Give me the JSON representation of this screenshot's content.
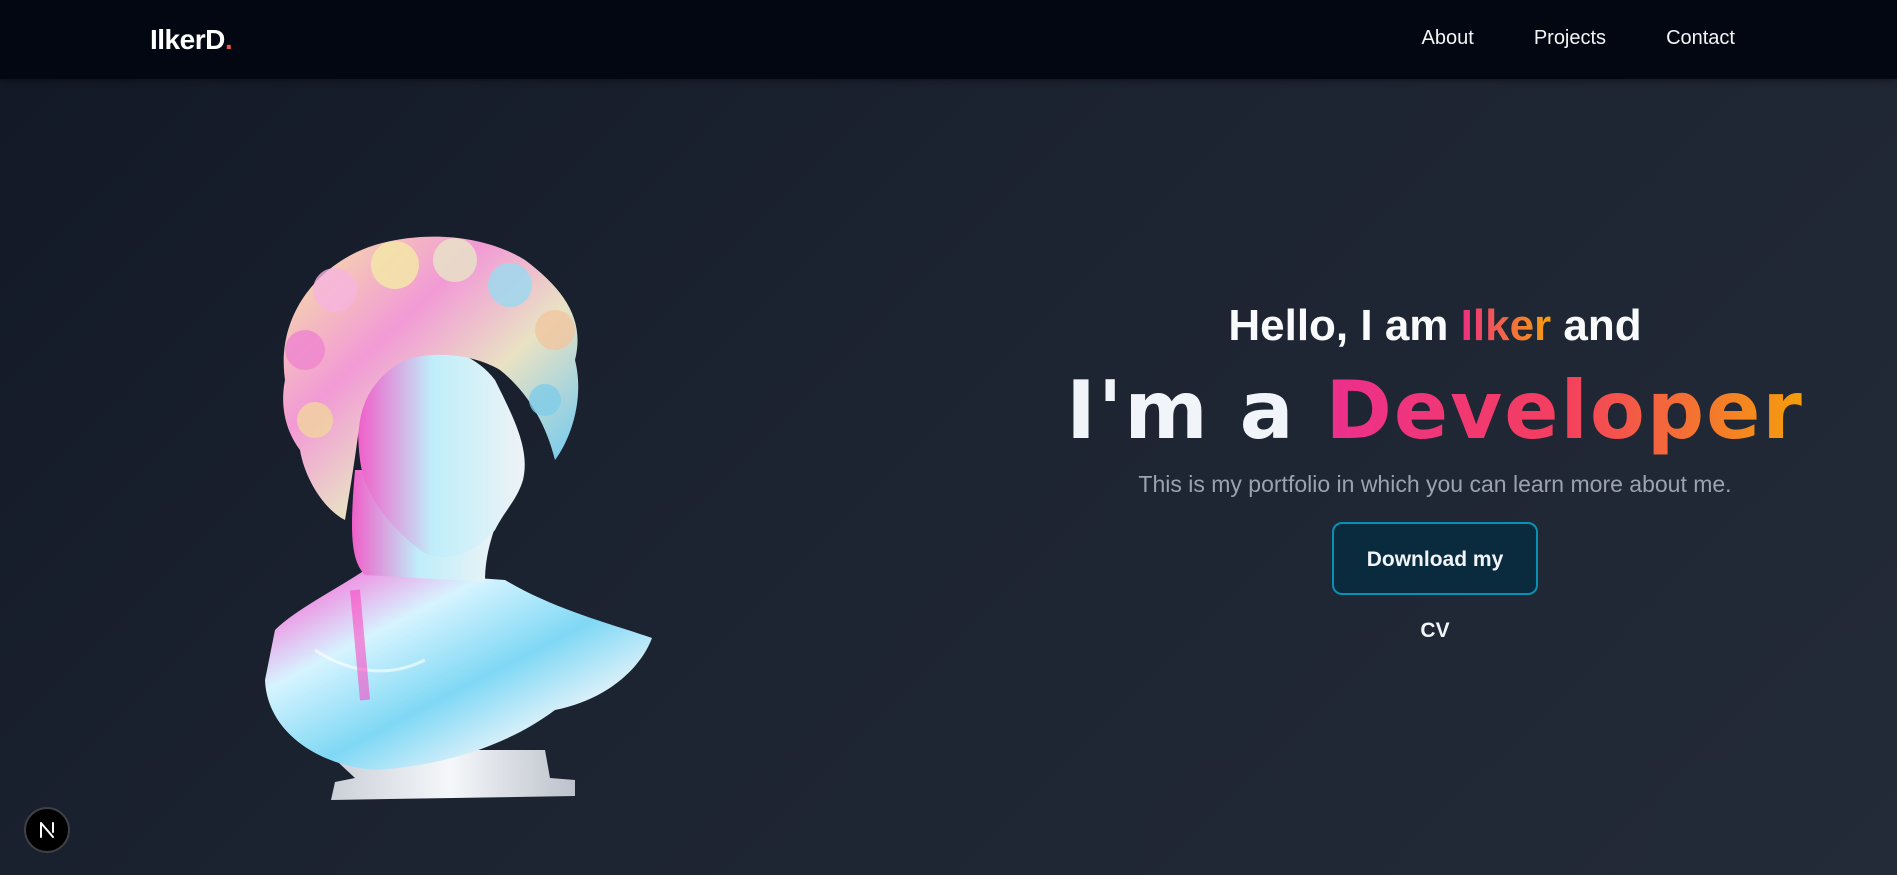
{
  "header": {
    "logo_main": "IlkerD",
    "logo_dot": ".",
    "nav": [
      {
        "label": "About"
      },
      {
        "label": "Projects"
      },
      {
        "label": "Contact"
      }
    ]
  },
  "hero": {
    "greeting_prefix": "Hello, I am ",
    "name": "Ilker",
    "greeting_suffix": " and",
    "role_prefix": "I'm a ",
    "role": "Developer",
    "subtitle": "This is my portfolio in which you can learn more about me.",
    "cta_label": "Download my CV"
  },
  "badge": {
    "letter": "N"
  },
  "colors": {
    "nav_bg": "#030712",
    "accent_pink": "#ec2f80",
    "accent_orange": "#f59e0b",
    "button_border": "#0891b2"
  }
}
